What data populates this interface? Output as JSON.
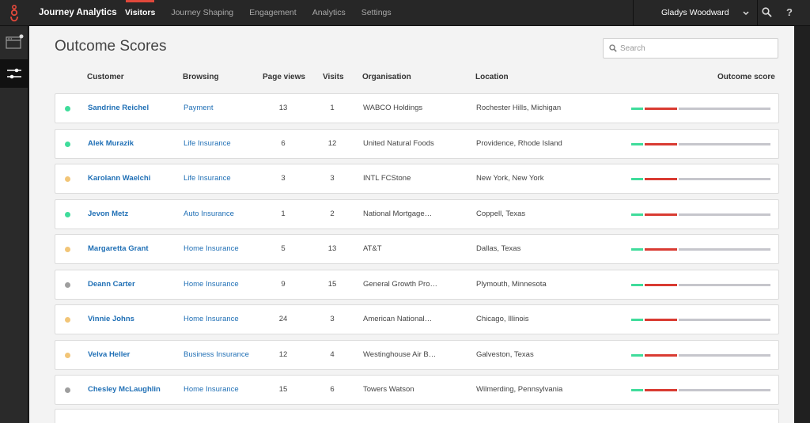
{
  "app": {
    "title": "Journey Analytics"
  },
  "nav": [
    {
      "label": "Visitors",
      "active": true
    },
    {
      "label": "Journey Shaping"
    },
    {
      "label": "Engagement"
    },
    {
      "label": "Analytics"
    },
    {
      "label": "Settings"
    }
  ],
  "user": {
    "name": "Gladys Woodward"
  },
  "page": {
    "title": "Outcome Scores"
  },
  "search": {
    "placeholder": "Search"
  },
  "headers": {
    "customer": "Customer",
    "browsing": "Browsing",
    "page_views": "Page views",
    "visits": "Visits",
    "organisation": "Organisation",
    "location": "Location",
    "outcome_score": "Outcome score"
  },
  "colors": {
    "green": "#3fdc9b",
    "yellow": "#f2c577",
    "grey": "#9e9e9e",
    "score_green": "#3fdc9b",
    "score_red": "#d93b32",
    "score_grey": "#c6c6cc",
    "link": "#1f6fb5",
    "accent": "#e0483b"
  },
  "icons": {
    "logo": "genesys-logo-icon",
    "search": "search-icon",
    "help": "help-icon",
    "chevron": "chevron-down-icon"
  },
  "rows": [
    {
      "status": "green",
      "name": "Sandrine Reichel",
      "browsing": "Payment",
      "page_views": "13",
      "visits": "1",
      "organisation": "WABCO Holdings",
      "location": "Rochester Hills, Michigan"
    },
    {
      "status": "green",
      "name": "Alek Murazik",
      "browsing": "Life Insurance",
      "page_views": "6",
      "visits": "12",
      "organisation": "United Natural Foods",
      "location": "Providence, Rhode Island"
    },
    {
      "status": "yellow",
      "name": "Karolann Waelchi",
      "browsing": "Life Insurance",
      "page_views": "3",
      "visits": "3",
      "organisation": "INTL FCStone",
      "location": "New York, New York"
    },
    {
      "status": "green",
      "name": "Jevon Metz",
      "browsing": "Auto Insurance",
      "page_views": "1",
      "visits": "2",
      "organisation": "National Mortgage…",
      "location": "Coppell, Texas"
    },
    {
      "status": "yellow",
      "name": "Margaretta Grant",
      "browsing": "Home Insurance",
      "page_views": "5",
      "visits": "13",
      "organisation": "AT&T",
      "location": "Dallas, Texas"
    },
    {
      "status": "grey",
      "name": "Deann Carter",
      "browsing": "Home Insurance",
      "page_views": "9",
      "visits": "15",
      "organisation": "General Growth Pro…",
      "location": "Plymouth, Minnesota"
    },
    {
      "status": "yellow",
      "name": "Vinnie Johns",
      "browsing": "Home Insurance",
      "page_views": "24",
      "visits": "3",
      "organisation": "American National…",
      "location": "Chicago, Illinois"
    },
    {
      "status": "yellow",
      "name": "Velva Heller",
      "browsing": "Business Insurance",
      "page_views": "12",
      "visits": "4",
      "organisation": "Westinghouse Air B…",
      "location": "Galveston, Texas"
    },
    {
      "status": "grey",
      "name": "Chesley McLaughlin",
      "browsing": "Home Insurance",
      "page_views": "15",
      "visits": "6",
      "organisation": "Towers Watson",
      "location": "Wilmerding, Pennsylvania"
    }
  ]
}
